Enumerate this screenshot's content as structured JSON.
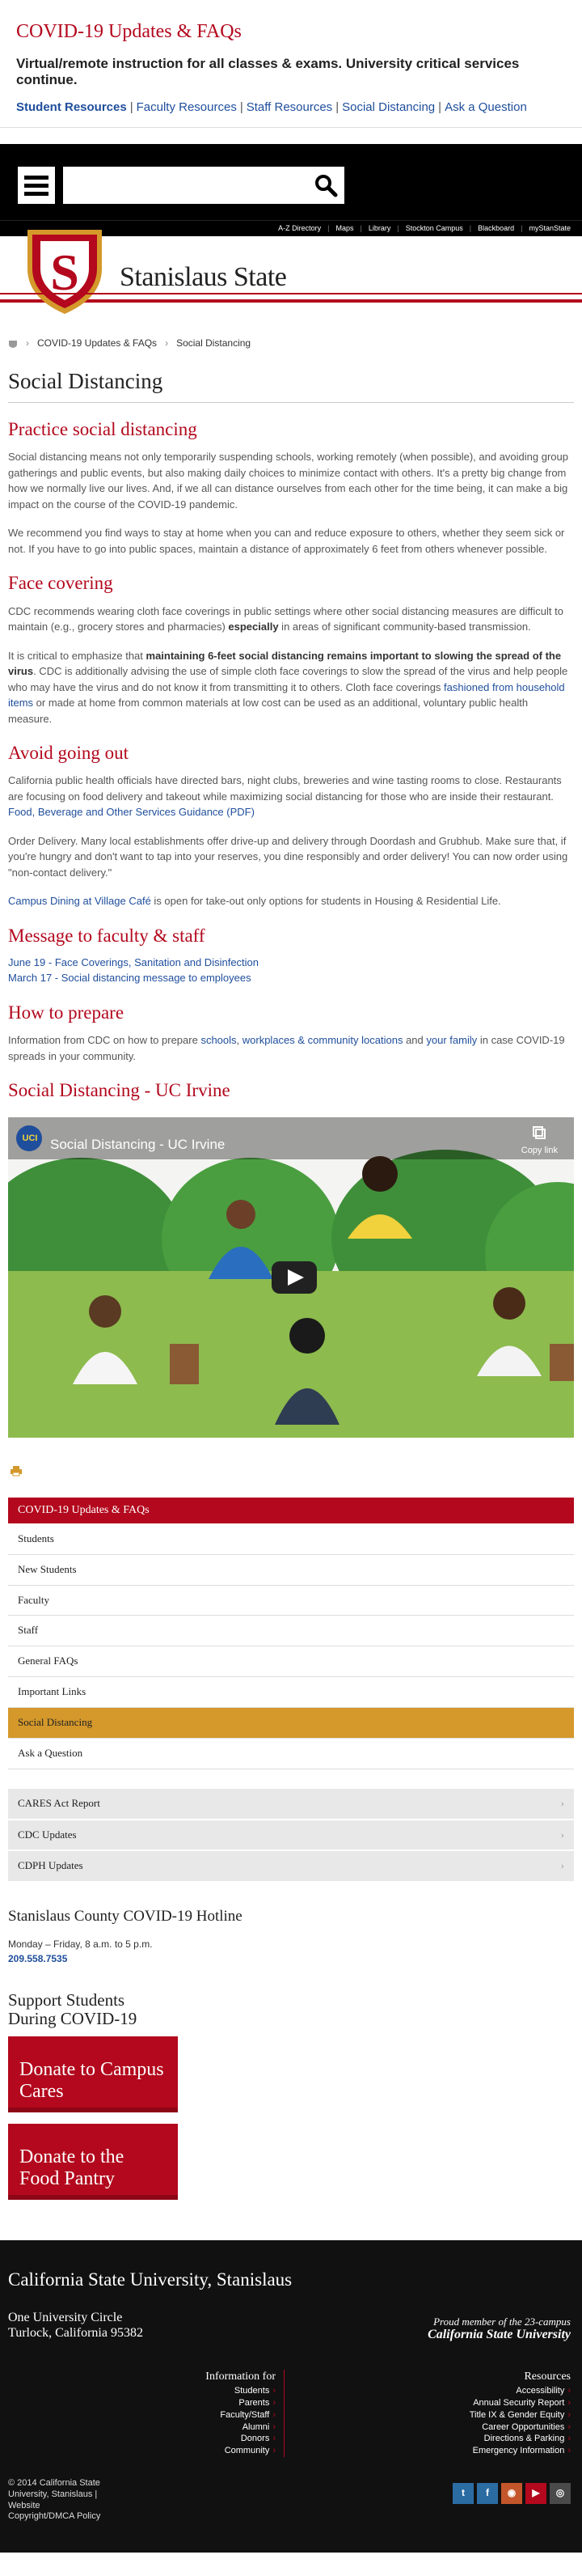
{
  "alert": {
    "title": "COVID-19 Updates & FAQs",
    "message": "Virtual/remote instruction for all classes & exams. University critical services continue.",
    "links": [
      "Student Resources",
      "Faculty Resources",
      "Staff Resources",
      "Social Distancing",
      "Ask a Question"
    ]
  },
  "utility_links": [
    "A-Z Directory",
    "Maps",
    "Library",
    "Stockton Campus",
    "Blackboard",
    "myStanState"
  ],
  "site": {
    "name": "Stanislaus State"
  },
  "breadcrumb": {
    "parent": "COVID-19 Updates & FAQs",
    "current": "Social Distancing"
  },
  "page_title": "Social Distancing",
  "sections": {
    "practice": {
      "heading": "Practice social distancing",
      "p1": "Social distancing means not only temporarily suspending schools, working remotely (when possible), and avoiding group gatherings and public events, but also making daily choices to minimize contact with others. It's a pretty big change from how we normally live our lives. And, if we all can distance ourselves from each other for the time being, it can make a big impact on the course of the COVID-19 pandemic.",
      "p2": "We recommend you find ways to stay at home when you can and reduce exposure to others, whether they seem sick or not. If you have to go into public spaces, maintain a distance of approximately 6 feet from others whenever possible."
    },
    "face": {
      "heading": "Face covering",
      "p1_a": "CDC recommends wearing cloth face coverings in public settings where other social distancing measures are difficult to maintain (e.g., grocery stores and pharmacies) ",
      "p1_b": "especially",
      "p1_c": " in areas of significant community-based transmission.",
      "p2_a": "It is critical to emphasize that ",
      "p2_b": "maintaining 6-feet social distancing remains important to slowing the spread of the virus",
      "p2_c": ". CDC is additionally advising the use of simple cloth face coverings to slow the spread of the virus and help people who may have the virus and do not know it from transmitting it to others. Cloth face coverings ",
      "p2_link": "fashioned from household items",
      "p2_d": " or made at home from common materials at low cost can be used as an additional, voluntary public health measure."
    },
    "avoid": {
      "heading": "Avoid going out",
      "p1_a": "California public health officials have directed bars, night clubs, breweries and wine tasting rooms to close. Restaurants are focusing on food delivery and takeout while maximizing social distancing for those who are inside their restaurant. ",
      "p1_link": "Food, Beverage and Other Services Guidance (PDF)",
      "p2": "Order Delivery. Many local establishments offer drive-up and delivery through Doordash and Grubhub. Make sure that, if you're hungry and don't want to tap into your reserves, you dine responsibly and order delivery! You can now order using \"non-contact delivery.\"",
      "p3_link": "Campus Dining at Village Café",
      "p3_b": " is open for take-out only options for students in Housing & Residential Life."
    },
    "message": {
      "heading": "Message to faculty & staff",
      "link1": "June 19 - Face Coverings, Sanitation and Disinfection",
      "link2": "March 17 - Social distancing message to employees"
    },
    "prepare": {
      "heading": "How to prepare",
      "p_a": "Information from CDC on how to prepare ",
      "l1": "schools",
      "sep1": ", ",
      "l2": "workplaces & community locations",
      "mid": " and ",
      "l3": "your family",
      "p_b": " in case COVID-19 spreads in your community."
    },
    "video": {
      "heading": "Social Distancing - UC Irvine",
      "title": "Social Distancing - UC Irvine",
      "copy": "Copy link",
      "channel": "UCI"
    }
  },
  "sidebar": {
    "header": "COVID-19 Updates & FAQs",
    "items": [
      "Students",
      "New Students",
      "Faculty",
      "Staff",
      "General FAQs",
      "Important Links",
      "Social Distancing",
      "Ask a Question"
    ],
    "external": [
      "CARES Act Report",
      "CDC Updates",
      "CDPH Updates"
    ]
  },
  "hotline": {
    "heading": "Stanislaus County COVID-19 Hotline",
    "hours": "Monday – Friday, 8 a.m. to 5 p.m.",
    "phone": "209.558.7535"
  },
  "support": {
    "heading": "Support Students During COVID-19",
    "btn1": "Donate to Campus Cares",
    "btn2": "Donate to the Food Pantry"
  },
  "footer": {
    "name": "California State University, Stanislaus",
    "addr1": "One University Circle",
    "addr2": "Turlock, California 95382",
    "proud1": "Proud member of the 23-campus",
    "proud2": "California State University",
    "info_heading": "Information for",
    "info_links": [
      "Students",
      "Parents",
      "Faculty/Staff",
      "Alumni",
      "Donors",
      "Community"
    ],
    "res_heading": "Resources",
    "res_links": [
      "Accessibility",
      "Annual Security Report",
      "Title IX & Gender Equity",
      "Career Opportunities",
      "Directions & Parking",
      "Emergency Information"
    ],
    "copyright1": "© 2014 California State University, Stanislaus |",
    "copyright2": "Website",
    "copyright3": "Copyright/DMCA Policy"
  },
  "colors": {
    "brand_red": "#b3081d",
    "active_gold": "#d4982b",
    "link_blue": "#1f4e9c"
  }
}
